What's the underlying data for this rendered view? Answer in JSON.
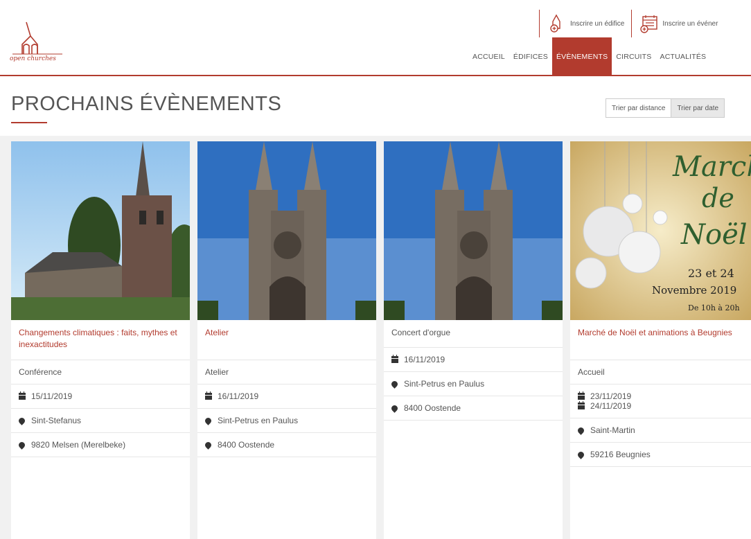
{
  "header": {
    "logo_text": "open churches",
    "actions": [
      {
        "label": "Inscrire un édifice",
        "icon": "church-plus-icon"
      },
      {
        "label": "Inscrire un événer",
        "icon": "calendar-plus-icon"
      }
    ],
    "nav": [
      {
        "label": "ACCUEIL",
        "active": false
      },
      {
        "label": "ÉDIFICES",
        "active": false
      },
      {
        "label": "ÉVÈNEMENTS",
        "active": true
      },
      {
        "label": "CIRCUITS",
        "active": false
      },
      {
        "label": "ACTUALITÉS",
        "active": false
      }
    ]
  },
  "page": {
    "title": "PROCHAINS ÉVÈNEMENTS",
    "sort": [
      "Trier par distance",
      "Trier par date"
    ]
  },
  "cards": [
    {
      "title": "Changements climatiques : faits, mythes et inexactitudes",
      "type": "Conférence",
      "dates": [
        "15/11/2019"
      ],
      "place": "Sint-Stefanus",
      "address": "9820 Melsen (Merelbeke)"
    },
    {
      "title": "Atelier",
      "type": "Atelier",
      "dates": [
        "16/11/2019"
      ],
      "place": "Sint-Petrus en Paulus",
      "address": "8400 Oostende"
    },
    {
      "title": "Concert d'orgue",
      "dates": [
        "16/11/2019"
      ],
      "place": "Sint-Petrus en Paulus",
      "address": "8400 Oostende"
    },
    {
      "title": "Marché de Noël et animations à Beugnies",
      "type": "Accueil",
      "dates": [
        "23/11/2019",
        "24/11/2019"
      ],
      "place": "Saint-Martin",
      "address": "59216 Beugnies",
      "poster": {
        "line1": "Marché",
        "line2": "de",
        "line3": "Noël",
        "line4": "23 et 24",
        "line5": "Novembre 2019",
        "line6": "De 10h à 20h"
      }
    }
  ],
  "colors": {
    "accent": "#b23b2e",
    "text": "#555555",
    "background": "#f1f1f1"
  }
}
